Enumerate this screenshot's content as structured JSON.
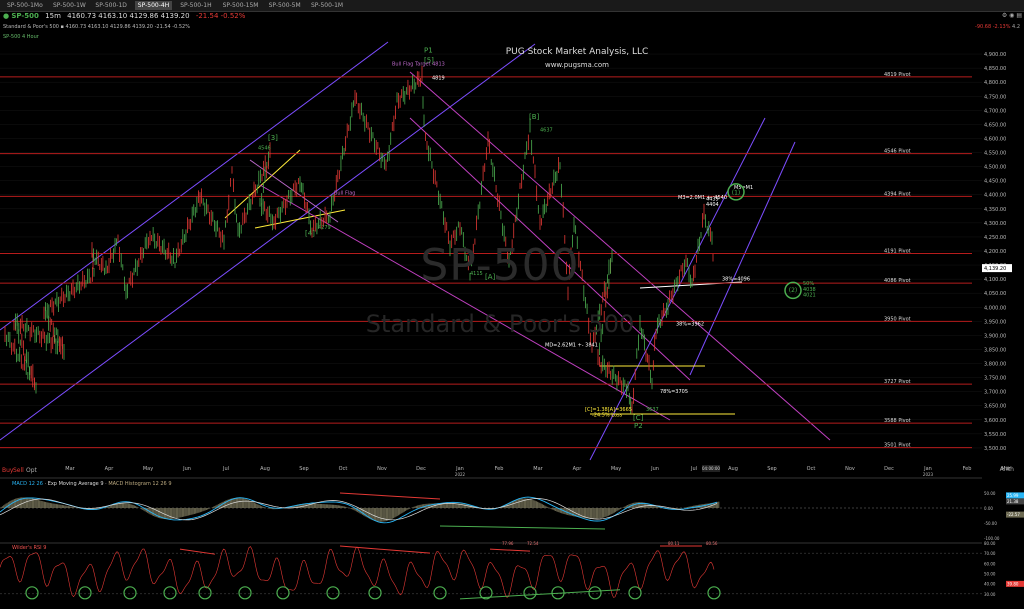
{
  "tabs": [
    "SP-500-1Mo",
    "SP-500-1W",
    "SP-500-1D",
    "SP-500-4H",
    "SP-500-1H",
    "SP-500-15M",
    "SP-500-5M",
    "SP-500-1M"
  ],
  "header": {
    "symbol": "SP-500",
    "timeframe": "15m",
    "quote": "4160.73  4163.10  4129.86  4139.20",
    "change": "-21.54  -0.52%",
    "subtitle": "Standard & Poor's 500 ▪ 4160.73 4163.10 4129.86 4139.20 -21.54 -0.52%",
    "study_label": "SP-500 4 Hour",
    "right_quote": "-90.68 -2.13%",
    "right_extra": "4.2"
  },
  "annotation": {
    "title": "PUG Stock Market Analysis, LLC",
    "url": "www.pugsma.com",
    "watermark_symbol": "SP-500",
    "watermark_name": "Standard & Poor's 500"
  },
  "chart_data": [
    {
      "type": "line",
      "name": "price-pane",
      "title": "SP-500 4 Hour",
      "x": [
        "Mar",
        "Apr",
        "May",
        "Jun",
        "Jul",
        "Aug",
        "Sep",
        "Oct",
        "Nov",
        "Dec",
        "Jan 2022",
        "Feb",
        "Mar",
        "Apr",
        "May",
        "Jun",
        "Jul",
        "Aug",
        "Sep",
        "Oct",
        "Nov",
        "Dec",
        "Jan 2023",
        "Feb",
        "Mar"
      ],
      "xlabel": "",
      "ylabel": "",
      "ylim": [
        3450,
        4950
      ],
      "yticks": [
        "4,900.00",
        "4,850.00",
        "4,800.00",
        "4,750.00",
        "4,700.00",
        "4,650.00",
        "4,600.00",
        "4,550.00",
        "4,500.00",
        "4,450.00",
        "4,400.00",
        "4,350.00",
        "4,300.00",
        "4,250.00",
        "4,200.00",
        "4,150.00",
        "4,100.00",
        "4,050.00",
        "4,000.00",
        "3,950.00",
        "3,900.00",
        "3,850.00",
        "3,800.00",
        "3,750.00",
        "3,700.00",
        "3,650.00",
        "3,600.00",
        "3,550.00",
        "3,500.00"
      ],
      "last_value": "4,139.20",
      "series": [
        {
          "values": [
            {
              "x": "Mar",
              "y": 3905
            },
            {
              "x": "Mar",
              "y": 3723
            },
            {
              "x": "Mar",
              "y": 3950
            },
            {
              "x": "Mar",
              "y": 3853
            },
            {
              "x": "Apr",
              "y": 3984
            },
            {
              "x": "Apr",
              "y": 4118
            },
            {
              "x": "Apr",
              "y": 4191
            },
            {
              "x": "May",
              "y": 4129
            },
            {
              "x": "May",
              "y": 4238
            },
            {
              "x": "May",
              "y": 4057
            },
            {
              "x": "Jun",
              "y": 4257
            },
            {
              "x": "Jun",
              "y": 4164
            },
            {
              "x": "Jul",
              "y": 4394
            },
            {
              "x": "Jul",
              "y": 4233
            },
            {
              "x": "Aug",
              "y": 4480
            },
            {
              "x": "Aug",
              "y": 4262
            },
            {
              "x": "Aug",
              "y": 4546
            },
            {
              "x": "Sep",
              "y": 4368
            },
            {
              "x": "Sep",
              "y": 4306
            },
            {
              "x": "Sep",
              "y": 4450
            },
            {
              "x": "Oct",
              "y": 4279
            },
            {
              "x": "Oct",
              "y": 4330
            },
            {
              "x": "Nov",
              "y": 4743
            },
            {
              "x": "Dec",
              "y": 4495
            },
            {
              "x": "Dec",
              "y": 4732
            },
            {
              "x": "Jan 2022",
              "y": 4819
            },
            {
              "x": "Jan 2022",
              "y": 4660
            },
            {
              "x": "Jan 2022",
              "y": 4582
            },
            {
              "x": "Feb",
              "y": 4223
            },
            {
              "x": "Feb",
              "y": 4292
            },
            {
              "x": "Feb",
              "y": 4115
            },
            {
              "x": "Mar",
              "y": 4595
            },
            {
              "x": "Mar",
              "y": 4155
            },
            {
              "x": "Mar",
              "y": 4417
            },
            {
              "x": "Apr",
              "y": 4637
            },
            {
              "x": "Apr",
              "y": 4301
            },
            {
              "x": "Apr",
              "y": 4512
            },
            {
              "x": "May",
              "y": 4063
            },
            {
              "x": "May",
              "y": 4306
            },
            {
              "x": "May",
              "y": 3858
            },
            {
              "x": "Jun",
              "y": 4177
            },
            {
              "x": "Jun",
              "y": 3810
            },
            {
              "x": "Jun",
              "y": 3706
            },
            {
              "x": "Jun",
              "y": 3637
            },
            {
              "x": "Jul",
              "y": 3946
            },
            {
              "x": "Jul",
              "y": 3739
            },
            {
              "x": "Jul",
              "y": 3919
            },
            {
              "x": "Jul",
              "y": 4012
            },
            {
              "x": "Aug",
              "y": 4167
            },
            {
              "x": "Aug",
              "y": 4080
            },
            {
              "x": "Aug",
              "y": 4326
            },
            {
              "x": "Aug",
              "y": 4233
            },
            {
              "x": "Aug",
              "y": 4139.2
            }
          ]
        }
      ],
      "pivots": [
        {
          "label": "4819 Pivot",
          "y": 4819
        },
        {
          "label": "4546 Pivot",
          "y": 4546
        },
        {
          "label": "4394 Pivot",
          "y": 4394
        },
        {
          "label": "4191 Pivot",
          "y": 4191
        },
        {
          "label": "4086 Pivot",
          "y": 4086
        },
        {
          "label": "3950 Pivot",
          "y": 3950
        },
        {
          "label": "3727 Pivot",
          "y": 3727
        },
        {
          "label": "3588 Pivot",
          "y": 3588
        },
        {
          "label": "3501 Pivot",
          "y": 3501
        }
      ],
      "annotations": [
        {
          "text": "P1",
          "x": "Jan 2022",
          "y": 4905,
          "color": "#4caf50"
        },
        {
          "text": "[5]",
          "x": "Jan 2022",
          "y": 4870,
          "color": "#4caf50"
        },
        {
          "text": "4819",
          "x": "Jan 2022",
          "y": 4810,
          "color": "#ffffff"
        },
        {
          "text": "Bull Flag Target 4813",
          "x": "Dec",
          "y": 4860,
          "color": "#ba68c8"
        },
        {
          "text": "Bull Flag",
          "x": "Oct",
          "y": 4400,
          "color": "#ba68c8"
        },
        {
          "text": "[3]",
          "x": "Aug",
          "y": 4595,
          "color": "#4caf50"
        },
        {
          "text": "4546",
          "x": "Aug",
          "y": 4560,
          "color": "#4caf50"
        },
        {
          "text": "[4]",
          "x": "Oct",
          "y": 4255,
          "color": "#4caf50"
        },
        {
          "text": "4279",
          "x": "Oct",
          "y": 4279,
          "color": "#4caf50"
        },
        {
          "text": "[B]",
          "x": "Apr",
          "y": 4670,
          "color": "#4caf50"
        },
        {
          "text": "4637",
          "x": "Apr",
          "y": 4625,
          "color": "#4caf50"
        },
        {
          "text": "[A]",
          "x": "Mar",
          "y": 4100,
          "color": "#4caf50"
        },
        {
          "text": "4115",
          "x": "Feb",
          "y": 4115,
          "color": "#4caf50"
        },
        {
          "text": "[C]",
          "x": "Jun",
          "y": 3600,
          "color": "#4caf50"
        },
        {
          "text": "P2",
          "x": "Jun",
          "y": 3570,
          "color": "#4caf50"
        },
        {
          "text": "3637",
          "x": "Jul",
          "y": 3632,
          "color": "#4caf50"
        },
        {
          "text": "[C]=1.38[A]=3665",
          "x": "Jun",
          "y": 3632,
          "color": "#ffeb3b"
        },
        {
          "text": "-24.5% Loss",
          "x": "Jun",
          "y": 3612,
          "color": "#ffeb3b"
        },
        {
          "text": "MD=2.62M1 +- 3841",
          "x": "May",
          "y": 3860,
          "color": "#ffffff"
        },
        {
          "text": "M3=2.0M1 +- 4540",
          "x": "Aug",
          "y": 4385,
          "color": "#ffffff"
        },
        {
          "text": "M5=M1",
          "x": "Aug",
          "y": 4410,
          "color": "#ffffff"
        },
        {
          "text": "4439",
          "x": "Aug",
          "y": 4400,
          "color": "#ffffff"
        },
        {
          "text": "4404",
          "x": "Aug",
          "y": 4390,
          "color": "#ffffff"
        },
        {
          "text": "38%=3962",
          "x": "Jul",
          "y": 3935,
          "color": "#ffffff"
        },
        {
          "text": "78%=3705",
          "x": "Jul",
          "y": 3695,
          "color": "#ffffff"
        },
        {
          "text": "38%=4096",
          "x": "Aug",
          "y": 4096,
          "color": "#ffffff"
        },
        {
          "text": "50%",
          "x": "Sep",
          "y": 4080,
          "color": "#4caf50"
        },
        {
          "text": "4038",
          "x": "Sep",
          "y": 4058,
          "color": "#4caf50"
        },
        {
          "text": "4021",
          "x": "Sep",
          "y": 4038,
          "color": "#4caf50"
        }
      ]
    },
    {
      "type": "line",
      "name": "macd-pane",
      "title": "MACD 12 26",
      "legend": [
        "MACD 12 26",
        "Exp Moving Average 9",
        "MACD Histogram 12 26 9"
      ],
      "ylim": [
        -100,
        100
      ],
      "yticks": [
        "50.00",
        "0.00",
        "-50.00",
        "-100.00"
      ],
      "last_values": [
        "25.99",
        "21.38",
        "-22.57"
      ]
    },
    {
      "type": "line",
      "name": "rsi-pane",
      "title": "Wilder's RSI 9",
      "ylim": [
        20,
        80
      ],
      "yticks": [
        "80.00",
        "70.00",
        "60.00",
        "50.00",
        "40.00",
        "30.00"
      ],
      "labels": [
        "77.96",
        "72.54",
        "80.11",
        "80.56"
      ],
      "last_value": "39.80"
    }
  ],
  "toolbar": {
    "buy": "Buy",
    "sell": "Sell",
    "opt": "Opt",
    "scale": "Arith",
    "date_badge": "04:00:00"
  }
}
